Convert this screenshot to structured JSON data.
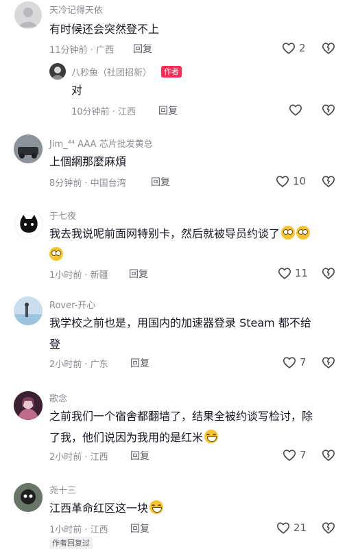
{
  "comments": [
    {
      "name": "天冷记得天依",
      "text": "有时候还会突然登不上",
      "time": "11分钟前 · 广西",
      "reply": "回复",
      "likes": "2"
    },
    {
      "name": "八秒鱼（社团招新）",
      "author_tag": "作者",
      "text": "对",
      "time": "10分钟前 · 江西",
      "reply": "回复",
      "likes": ""
    },
    {
      "name": "Jim_⁴⁴ AAA 芯片批发黄总",
      "text": "上個網那麼麻煩",
      "time": "8分钟前 · 中国台湾",
      "reply": "回复",
      "likes": "10"
    },
    {
      "name": "于七夜",
      "text": "我去我说呢前面网特别卡，然后就被导员约谈了",
      "time": "1小时前 · 新疆",
      "reply": "回复",
      "likes": "11"
    },
    {
      "name": "Rover-开心",
      "text_line1": "我学校之前也是，用国内的加速器登录 Steam 都不给",
      "text_line2": "登",
      "time": "2小时前 · 广东",
      "reply": "回复",
      "likes": "7"
    },
    {
      "name": "歌念",
      "text_line1": "之前我们一个宿舍都翻墙了，结果全被约谈写检讨，除",
      "text_line2": "了我，他们说因为我用的是红米",
      "time": "2小时前 · 江西",
      "reply": "回复",
      "likes": "7"
    },
    {
      "name": "尧十三",
      "text": "江西革命红区这一块",
      "time": "1小时前 · 江西",
      "reply": "回复",
      "likes": "21",
      "author_replied": "作者回复过"
    }
  ],
  "icons": {
    "like": "heart-outline-icon",
    "dislike": "broken-heart-icon"
  }
}
